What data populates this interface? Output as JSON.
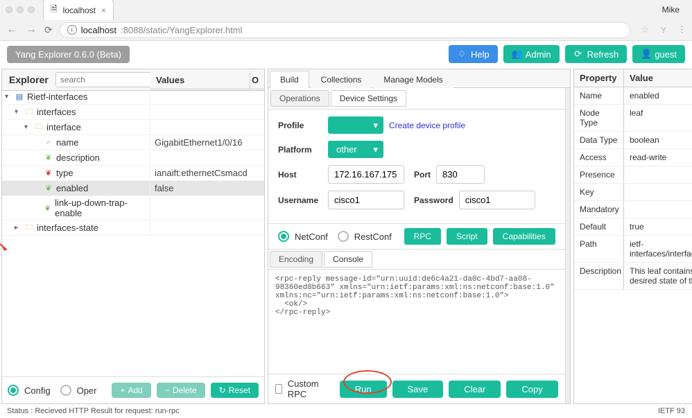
{
  "browser": {
    "tab_title": "localhost",
    "user": "Mike",
    "url_host": "localhost",
    "url_path": ":8088/static/YangExplorer.html"
  },
  "app": {
    "title": "Yang Explorer 0.6.0 (Beta)",
    "help": "Help",
    "admin": "Admin",
    "refresh": "Refresh",
    "guest": "guest"
  },
  "explorer": {
    "title": "Explorer",
    "search_placeholder": "search",
    "values_header": "Values",
    "ops_header": "O",
    "rows": [
      {
        "indent": 0,
        "caret": "▾",
        "icon": "book-blue",
        "glyph": "▤",
        "label": "Rietf-interfaces",
        "value": ""
      },
      {
        "indent": 1,
        "caret": "▾",
        "icon": "folder-open",
        "glyph": "🗀",
        "label": "interfaces",
        "value": ""
      },
      {
        "indent": 2,
        "caret": "▾",
        "icon": "folder-open",
        "glyph": "🗀",
        "label": "interface",
        "value": ""
      },
      {
        "indent": 3,
        "caret": "",
        "icon": "key-grey",
        "glyph": "⌕",
        "label": "name",
        "value": "GigabitEthernet1/0/16"
      },
      {
        "indent": 3,
        "caret": "",
        "icon": "leaf-green",
        "glyph": "❦",
        "label": "description",
        "value": ""
      },
      {
        "indent": 3,
        "caret": "",
        "icon": "leaf-red",
        "glyph": "❦",
        "label": "type",
        "value": "ianaift:ethernetCsmacd"
      },
      {
        "indent": 3,
        "caret": "",
        "icon": "leaf-green",
        "glyph": "❦",
        "label": "enabled",
        "value": "false",
        "hl": true
      },
      {
        "indent": 3,
        "caret": "",
        "icon": "leaf-green",
        "glyph": "❦",
        "label": "link-up-down-trap-enable",
        "value": ""
      },
      {
        "indent": 1,
        "caret": "▸",
        "icon": "folder-open",
        "glyph": "🗀",
        "label": "interfaces-state",
        "value": ""
      }
    ],
    "config": "Config",
    "oper": "Oper",
    "add": "Add",
    "delete": "Delete",
    "reset": "Reset"
  },
  "mid": {
    "tabs": {
      "build": "Build",
      "collections": "Collections",
      "manage": "Manage Models"
    },
    "subtabs": {
      "operations": "Operations",
      "device": "Device Settings"
    },
    "profile_label": "Profile",
    "create_profile": "Create device profile",
    "platform_label": "Platform",
    "platform_value": "other",
    "host_label": "Host",
    "host_value": "172.16.167.175",
    "port_label": "Port",
    "port_value": "830",
    "username_label": "Username",
    "username_value": "cisco1",
    "password_label": "Password",
    "password_value": "cisco1",
    "netconf": "NetConf",
    "restconf": "RestConf",
    "rpc": "RPC",
    "script": "Script",
    "capabilities": "Capabilities",
    "encoding": "Encoding",
    "console": "Console",
    "console_text": "<rpc-reply message-id=\"urn:uuid:de6c4a21-da0c-4bd7-aa08-98360ed8b663\" xmlns=\"urn:ietf:params:xml:ns:netconf:base:1.0\" xmlns:nc=\"urn:ietf:params:xml:ns:netconf:base:1.0\">\n  <ok/>\n</rpc-reply>",
    "custom_rpc": "Custom RPC",
    "run": "Run",
    "save": "Save",
    "clear": "Clear",
    "copy": "Copy"
  },
  "props": {
    "prop_header": "Property",
    "val_header": "Value",
    "rows": [
      {
        "k": "Name",
        "v": "enabled"
      },
      {
        "k": "Node Type",
        "v": "leaf"
      },
      {
        "k": "Data Type",
        "v": "boolean"
      },
      {
        "k": "Access",
        "v": "read-write"
      },
      {
        "k": "Presence",
        "v": ""
      },
      {
        "k": "Key",
        "v": ""
      },
      {
        "k": "Mandatory",
        "v": ""
      },
      {
        "k": "Default",
        "v": "true"
      },
      {
        "k": "Path",
        "v": "ietf-interfaces/interfaces/interface/enabled"
      },
      {
        "k": "Description",
        "v": "This leaf contains the configured, desired state of the interface."
      }
    ]
  },
  "status": {
    "left": "Status : Recieved HTTP Result for request: run-rpc",
    "right": "IETF 93"
  }
}
